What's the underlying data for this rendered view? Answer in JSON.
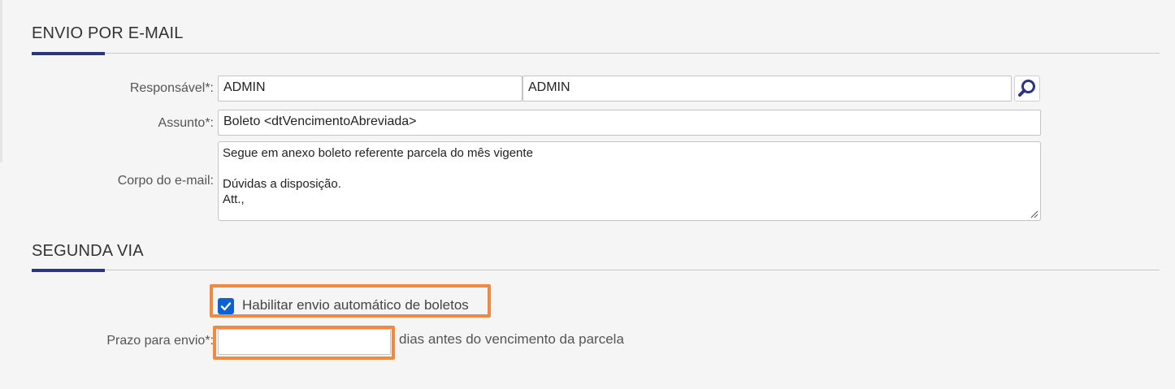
{
  "sections": {
    "email": {
      "title": "ENVIO POR E-MAIL"
    },
    "segunda_via": {
      "title": "SEGUNDA VIA"
    }
  },
  "email_form": {
    "responsavel": {
      "label": "Responsável*:",
      "code": "ADMIN",
      "name": "ADMIN"
    },
    "assunto": {
      "label": "Assunto*:",
      "value": "Boleto <dtVencimentoAbreviada>"
    },
    "corpo": {
      "label": "Corpo do e-mail:",
      "lines": [
        "Segue em anexo boleto referente parcela do mês vigente",
        "",
        "Dúvidas a disposição.",
        "Att.,"
      ]
    },
    "search_icon": "magnifier-icon"
  },
  "segunda_via_form": {
    "habilitar": {
      "label": "Habilitar envio automático de boletos",
      "checked": true
    },
    "prazo": {
      "label": "Prazo para envio*:",
      "value": "",
      "suffix": "dias antes do vencimento da parcela"
    }
  },
  "colors": {
    "accent": "#2d3480",
    "highlight": "#f08a42",
    "checkbox": "#0a62d4"
  }
}
